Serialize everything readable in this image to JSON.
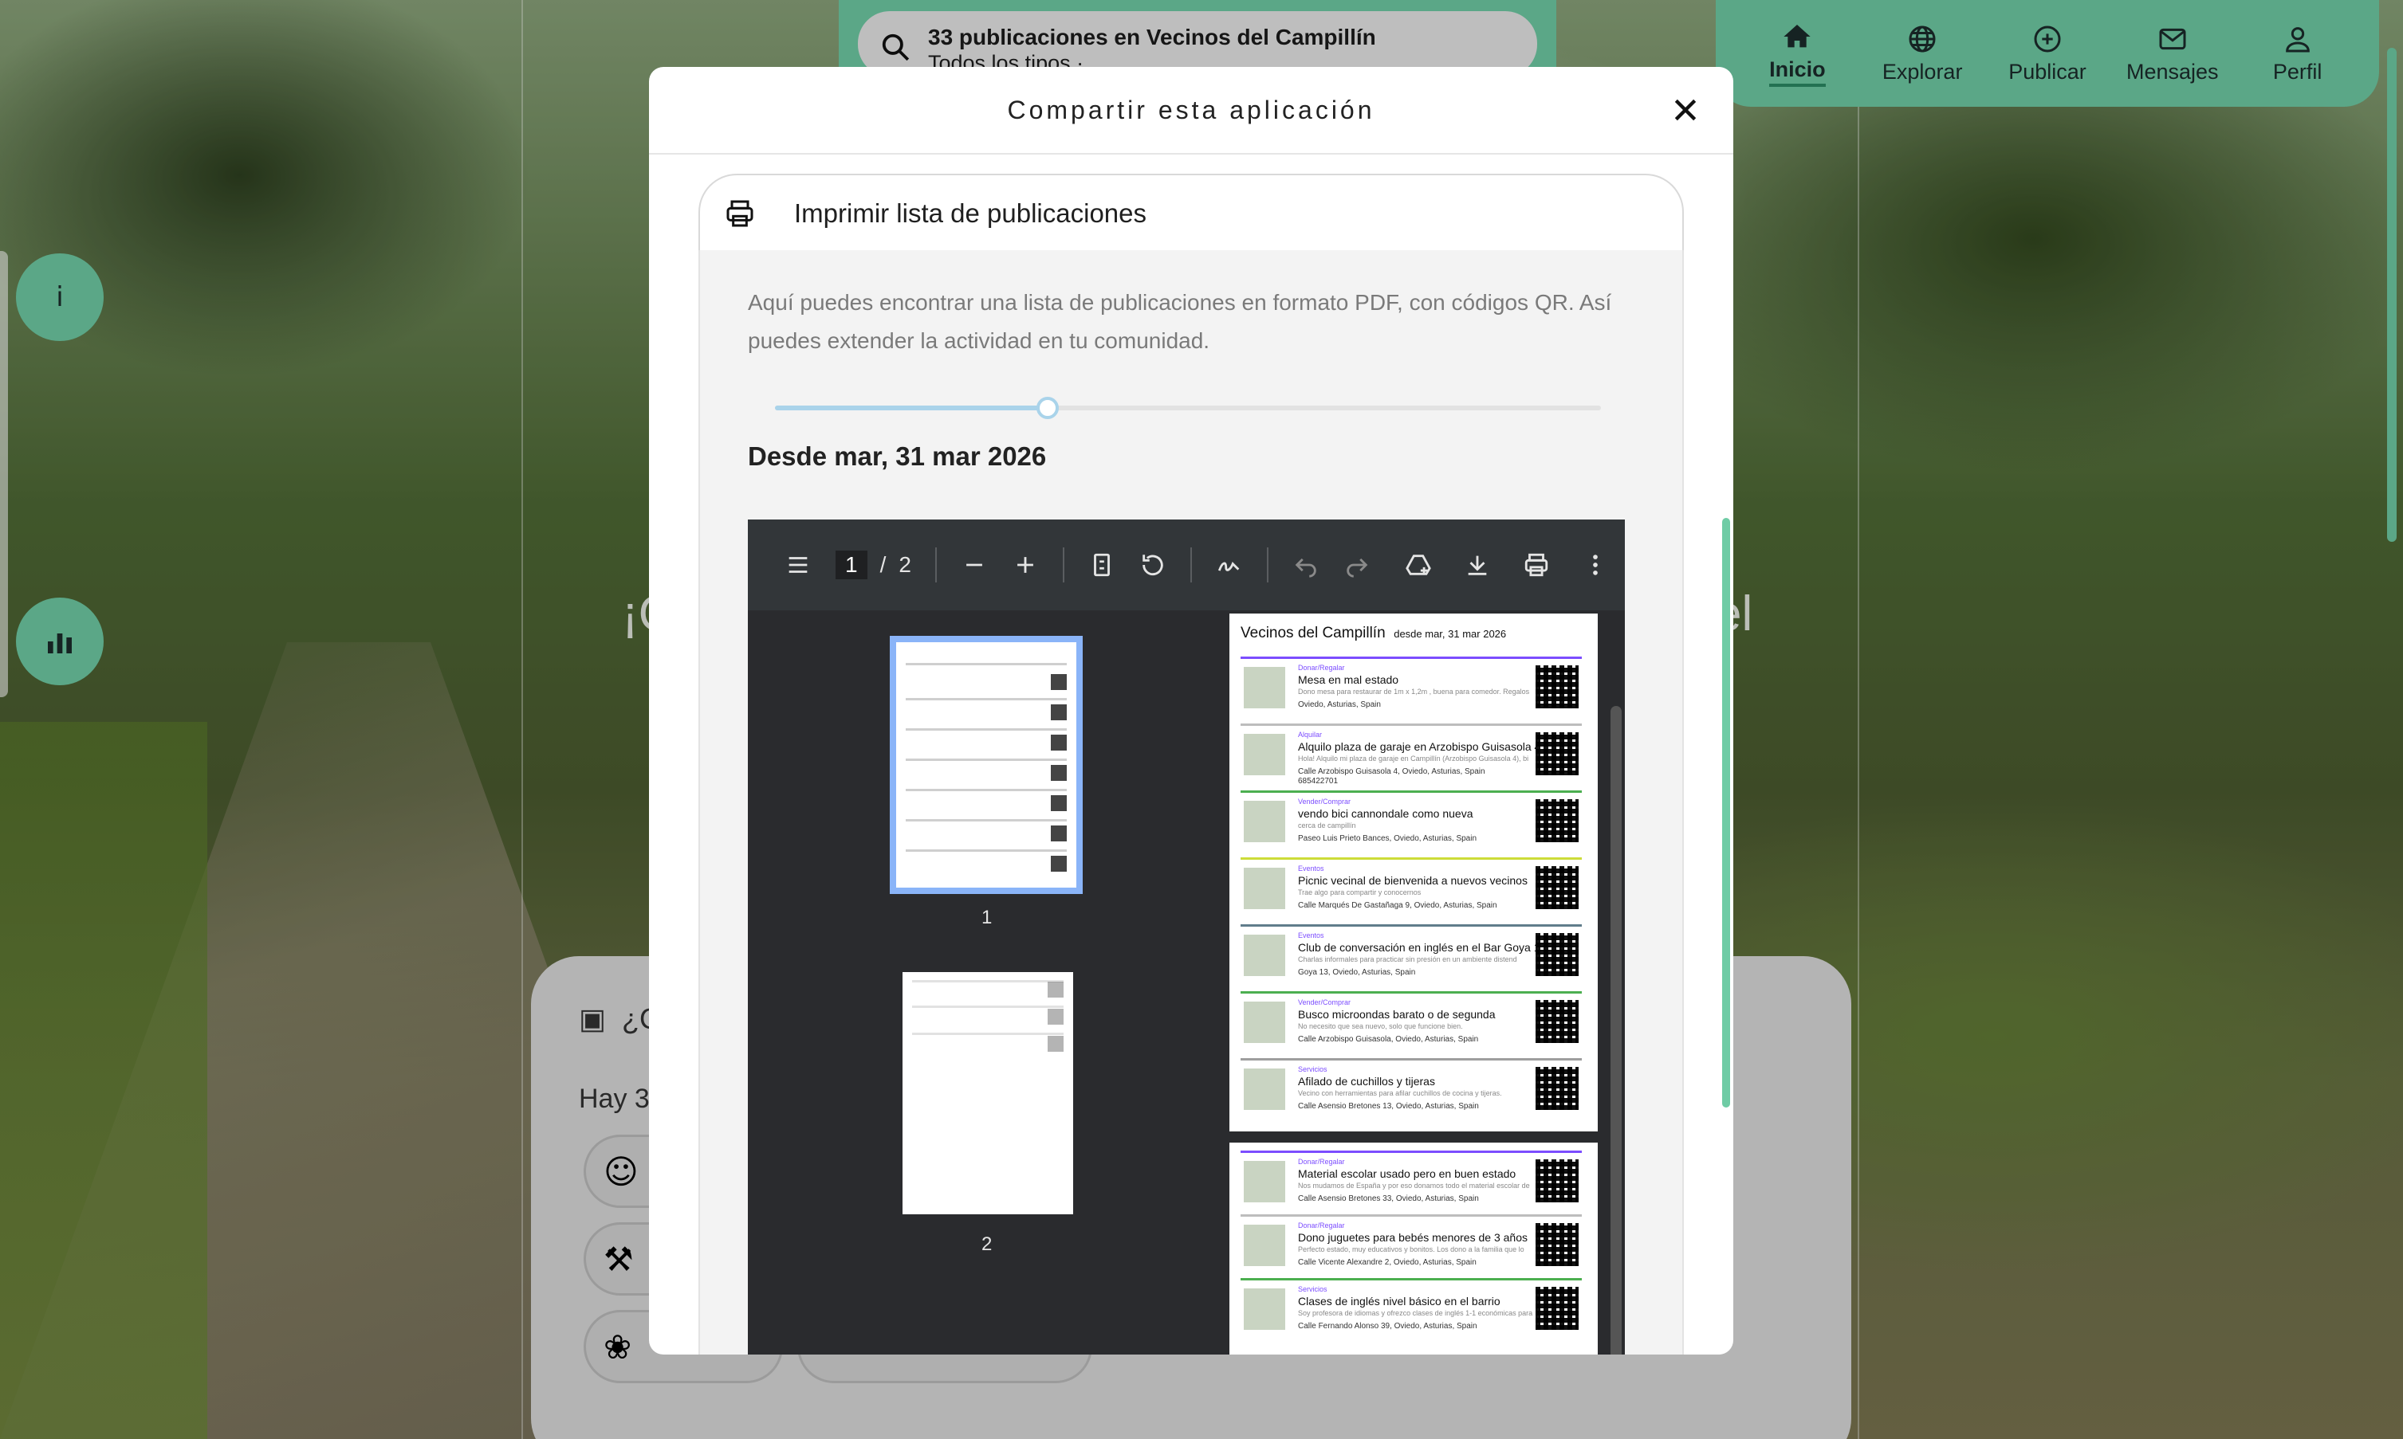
{
  "colors": {
    "accent": "#6fcca5",
    "accent_dark": "#2b8a64",
    "slider": "#a9d3ea"
  },
  "search": {
    "title": "33 publicaciones en Vecinos del Campillín",
    "subtitle": "Todos los tipos ·",
    "icon": "search-icon"
  },
  "nav": {
    "items": [
      {
        "label": "Inicio",
        "icon": "home-icon",
        "active": true
      },
      {
        "label": "Explorar",
        "icon": "globe-icon"
      },
      {
        "label": "Publicar",
        "icon": "plus-circle-icon"
      },
      {
        "label": "Mensajes",
        "icon": "envelope-icon"
      },
      {
        "label": "Perfil",
        "icon": "user-icon"
      }
    ]
  },
  "side": {
    "info_label": "i",
    "stats_icon": "bar-chart-icon"
  },
  "background": {
    "heading_left": "¡C",
    "heading_right": "el",
    "panel_prefix": "¿C",
    "hay": "Hay 3"
  },
  "modal": {
    "title": "Compartir esta aplicación",
    "close_icon": "close-icon",
    "section": {
      "label": "Imprimir lista de publicaciones",
      "icon": "printer-icon"
    },
    "description": "Aquí puedes encontrar una lista de publicaciones en formato PDF, con códigos QR. Así puedes extender la actividad en tu comunidad.",
    "slider_value": 0.33,
    "since": "Desde mar, 31 mar 2026"
  },
  "pdf": {
    "current_page": "1",
    "separator": "/",
    "total_pages": "2",
    "thumb_labels": [
      "1",
      "2"
    ],
    "header_title": "Vecinos del Campillín",
    "header_since": "desde mar, 31 mar 2026",
    "page1": [
      {
        "cat": "Donar/Regalar",
        "title": "Mesa en mal estado",
        "sub": "Dono mesa para restaurar de 1m x 1,2m , buena para comedor. Regalos",
        "addr": "Oviedo, Asturias, Spain"
      },
      {
        "cat": "Alquilar",
        "title": "Alquilo plaza de garaje en Arzobispo Guisasola 4",
        "sub": "Hola! Alquilo mi plaza de garaje en Campillín (Arzobispo Guisasola 4), bi",
        "addr": "Calle Arzobispo Guisasola 4, Oviedo, Asturias, Spain",
        "phone": "685422701"
      },
      {
        "cat": "Vender/Comprar",
        "title": "vendo bici cannondale como nueva",
        "sub": "cerca de campillín",
        "addr": "Paseo Luis Prieto Bances, Oviedo, Asturias, Spain"
      },
      {
        "cat": "Eventos",
        "title": "Picnic vecinal de bienvenida a nuevos vecinos",
        "sub": "Trae algo para compartir y conocernos",
        "addr": "Calle Marqués De Gastañaga 9, Oviedo, Asturias, Spain"
      },
      {
        "cat": "Eventos",
        "title": "Club de conversación en inglés en el Bar Goya 13",
        "sub": "Charlas informales para practicar sin presión en un ambiente distend",
        "addr": "Goya 13, Oviedo, Asturias, Spain"
      },
      {
        "cat": "Vender/Comprar",
        "title": "Busco microondas barato o de segunda",
        "sub": "No necesito que sea nuevo, solo que funcione bien.",
        "addr": "Calle Arzobispo Guisasola, Oviedo, Asturias, Spain"
      },
      {
        "cat": "Servicios",
        "title": "Afilado de cuchillos y tijeras",
        "sub": "Vecino con herramientas para afilar cuchillos de cocina y tijeras.",
        "addr": "Calle Asensio Bretones 13, Oviedo, Asturias, Spain"
      }
    ],
    "page2": [
      {
        "cat": "Donar/Regalar",
        "title": "Material escolar usado pero en buen estado",
        "sub": "Nos mudamos de España y por eso donamos todo el material escolar de",
        "addr": "Calle Asensio Bretones 33, Oviedo, Asturias, Spain"
      },
      {
        "cat": "Donar/Regalar",
        "title": "Dono juguetes para bebés menores de 3 años",
        "sub": "Perfecto estado, muy educativos y bonitos. Los dono a la familia que lo",
        "addr": "Calle Vicente Alexandre 2, Oviedo, Asturias, Spain"
      },
      {
        "cat": "Servicios",
        "title": "Clases de inglés nivel básico en el barrio",
        "sub": "Soy profesora de idiomas y ofrezco clases de inglés 1-1 económicas para",
        "addr": "Calle Fernando Alonso 39, Oviedo, Asturias, Spain"
      }
    ]
  }
}
